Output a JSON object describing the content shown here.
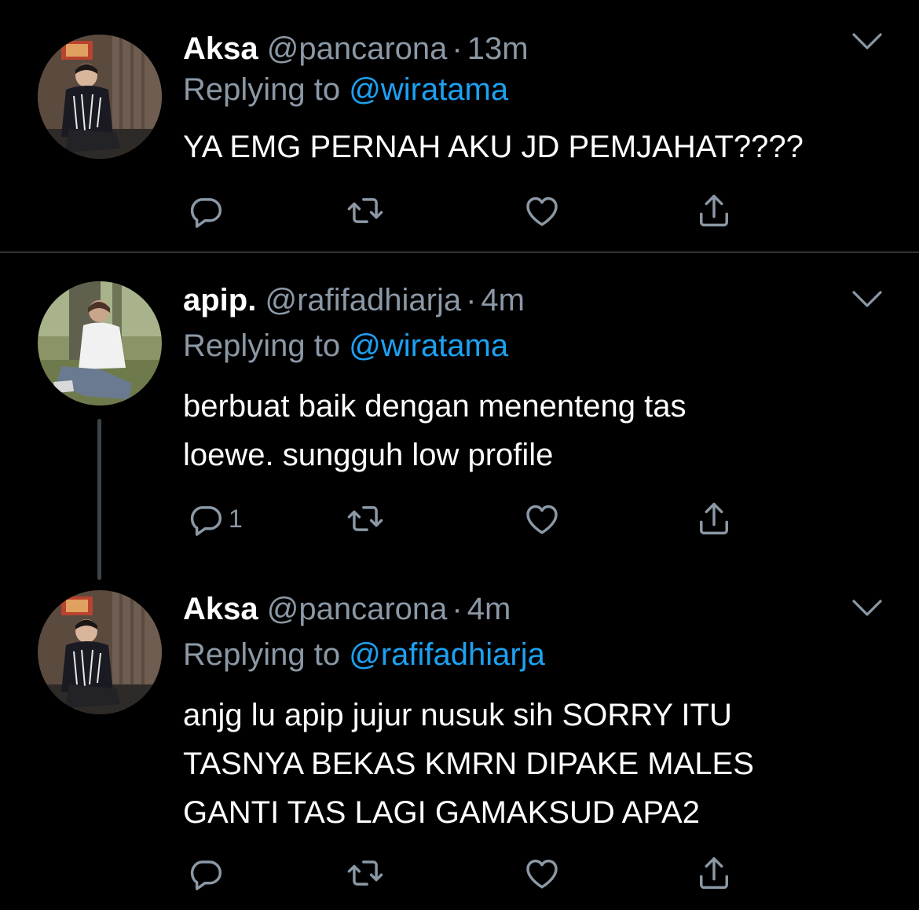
{
  "colors": {
    "background": "#000000",
    "secondary_text": "#8b98a5",
    "link": "#1da1f2",
    "divider": "#2f3336"
  },
  "tweets": [
    {
      "name": "Aksa",
      "handle": "@pancarona",
      "separator": "·",
      "time": "13m",
      "reply_prefix": "Replying to",
      "reply_to": "@wiratama",
      "text": "YA EMG PERNAH AKU JD PEMJAHAT????",
      "reply_count": "",
      "icons": [
        "reply-icon",
        "retweet-icon",
        "like-icon",
        "share-icon",
        "chevron-down-icon"
      ]
    },
    {
      "name": "apip.",
      "handle": "@rafifadhiarja",
      "separator": "·",
      "time": "4m",
      "reply_prefix": "Replying to",
      "reply_to": "@wiratama",
      "text": "berbuat baik dengan menenteng tas\nloewe. sungguh low profile",
      "reply_count": "1",
      "icons": [
        "reply-icon",
        "retweet-icon",
        "like-icon",
        "share-icon",
        "chevron-down-icon"
      ]
    },
    {
      "name": "Aksa",
      "handle": "@pancarona",
      "separator": "·",
      "time": "4m",
      "reply_prefix": "Replying to",
      "reply_to": "@rafifadhiarja",
      "text": "anjg lu apip jujur nusuk sih SORRY ITU\nTASNYA BEKAS KMRN DIPAKE MALES\nGANTI TAS LAGI GAMAKSUD APA2",
      "reply_count": "",
      "icons": [
        "reply-icon",
        "retweet-icon",
        "like-icon",
        "share-icon",
        "chevron-down-icon"
      ]
    }
  ]
}
